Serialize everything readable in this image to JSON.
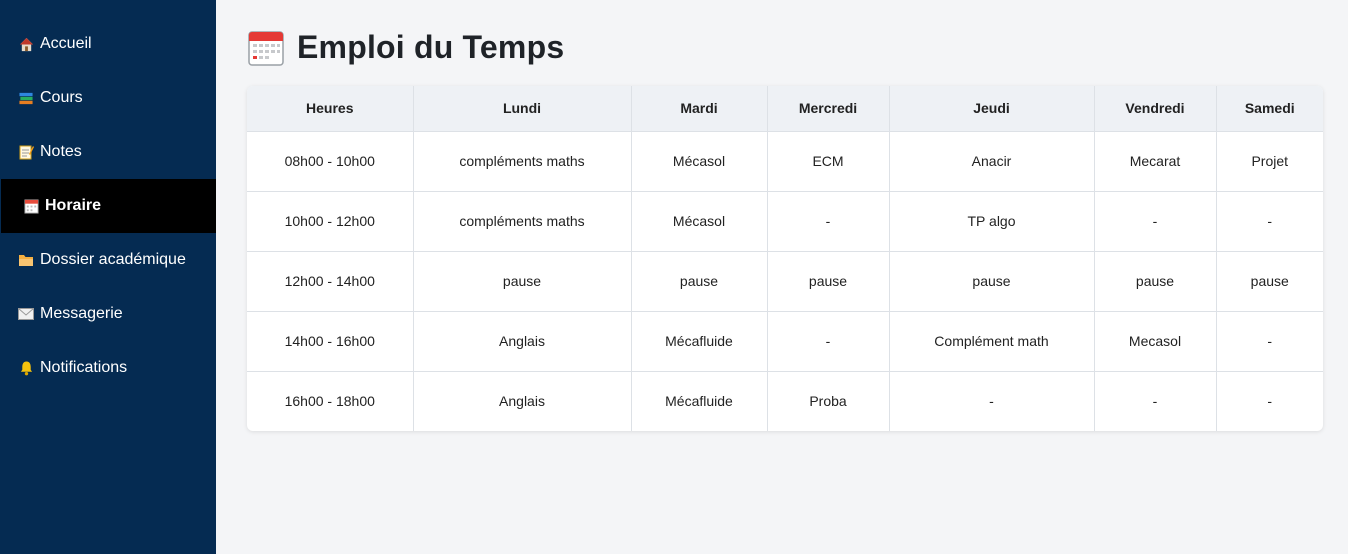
{
  "sidebar": {
    "items": [
      {
        "icon": "house-icon",
        "label": "Accueil"
      },
      {
        "icon": "books-icon",
        "label": "Cours"
      },
      {
        "icon": "memo-icon",
        "label": "Notes"
      },
      {
        "icon": "calendar-icon",
        "label": "Horaire"
      },
      {
        "icon": "folder-icon",
        "label": "Dossier académique"
      },
      {
        "icon": "envelope-icon",
        "label": "Messagerie"
      },
      {
        "icon": "bell-icon",
        "label": "Notifications"
      }
    ],
    "active": "Horaire"
  },
  "page": {
    "title": "Emploi du Temps",
    "title_icon": "calendar-icon"
  },
  "timetable": {
    "headers": [
      "Heures",
      "Lundi",
      "Mardi",
      "Mercredi",
      "Jeudi",
      "Vendredi",
      "Samedi"
    ],
    "rows": [
      [
        "08h00 - 10h00",
        "compléments maths",
        "Mécasol",
        "ECM",
        "Anacir",
        "Mecarat",
        "Projet"
      ],
      [
        "10h00 - 12h00",
        "compléments maths",
        "Mécasol",
        "-",
        "TP algo",
        "-",
        "-"
      ],
      [
        "12h00 - 14h00",
        "pause",
        "pause",
        "pause",
        "pause",
        "pause",
        "pause"
      ],
      [
        "14h00 - 16h00",
        "Anglais",
        "Mécafluide",
        "-",
        "Complément math",
        "Mecasol",
        "-"
      ],
      [
        "16h00 - 18h00",
        "Anglais",
        "Mécafluide",
        "Proba",
        "-",
        "-",
        "-"
      ]
    ]
  },
  "colors": {
    "sidebar_bg": "#052b52",
    "active_bg": "#000000",
    "page_bg": "#f4f5f7",
    "header_bg": "#eef1f5"
  }
}
